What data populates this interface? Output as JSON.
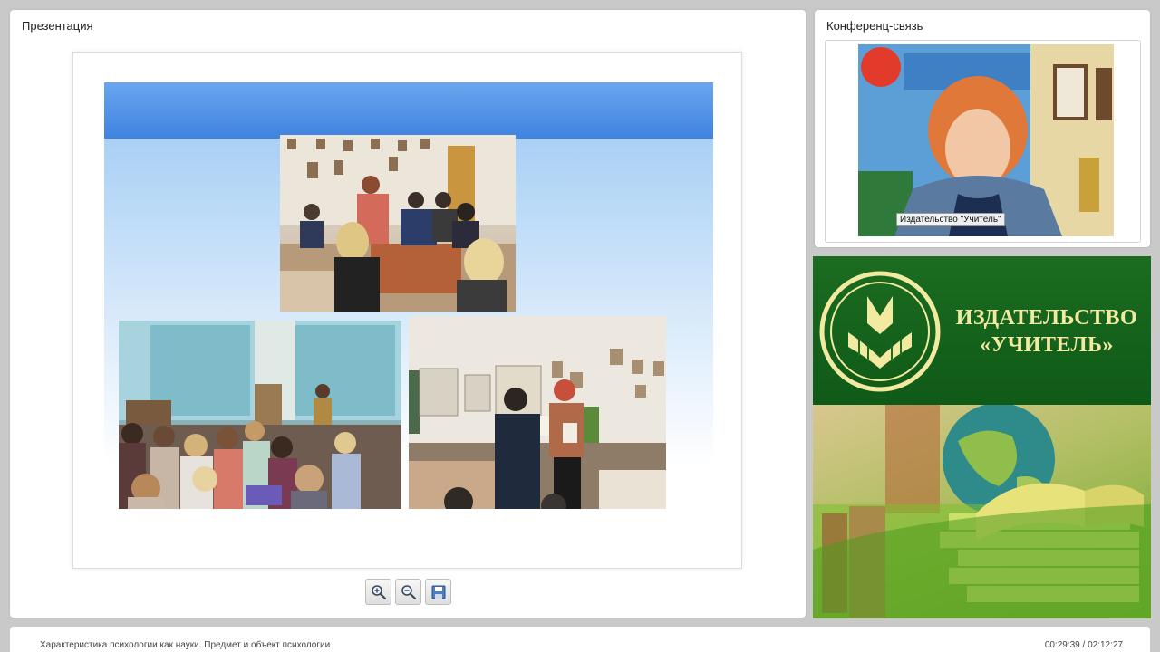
{
  "presentation": {
    "title": "Презентация"
  },
  "toolbar": {
    "zoom_in_icon": "zoom-in-icon",
    "zoom_out_icon": "zoom-out-icon",
    "save_icon": "save-icon"
  },
  "conference": {
    "title": "Конференц-связь",
    "caption": "Издательство \"Учитель\""
  },
  "banner": {
    "name_line1": "ИЗДАТЕЛЬСТВО",
    "name_line2": "«УЧИТЕЛЬ»"
  },
  "status": {
    "lecture_title": "Характеристика психологии как науки. Предмет и объект психологии",
    "elapsed": "00:29:39",
    "total": "02:12:27",
    "time_display": "00:29:39 / 02:12:27"
  },
  "colors": {
    "banner_green": "#1c6c21",
    "banner_text": "#f3eaa2",
    "slide_header_blue": "#3f83e0"
  }
}
